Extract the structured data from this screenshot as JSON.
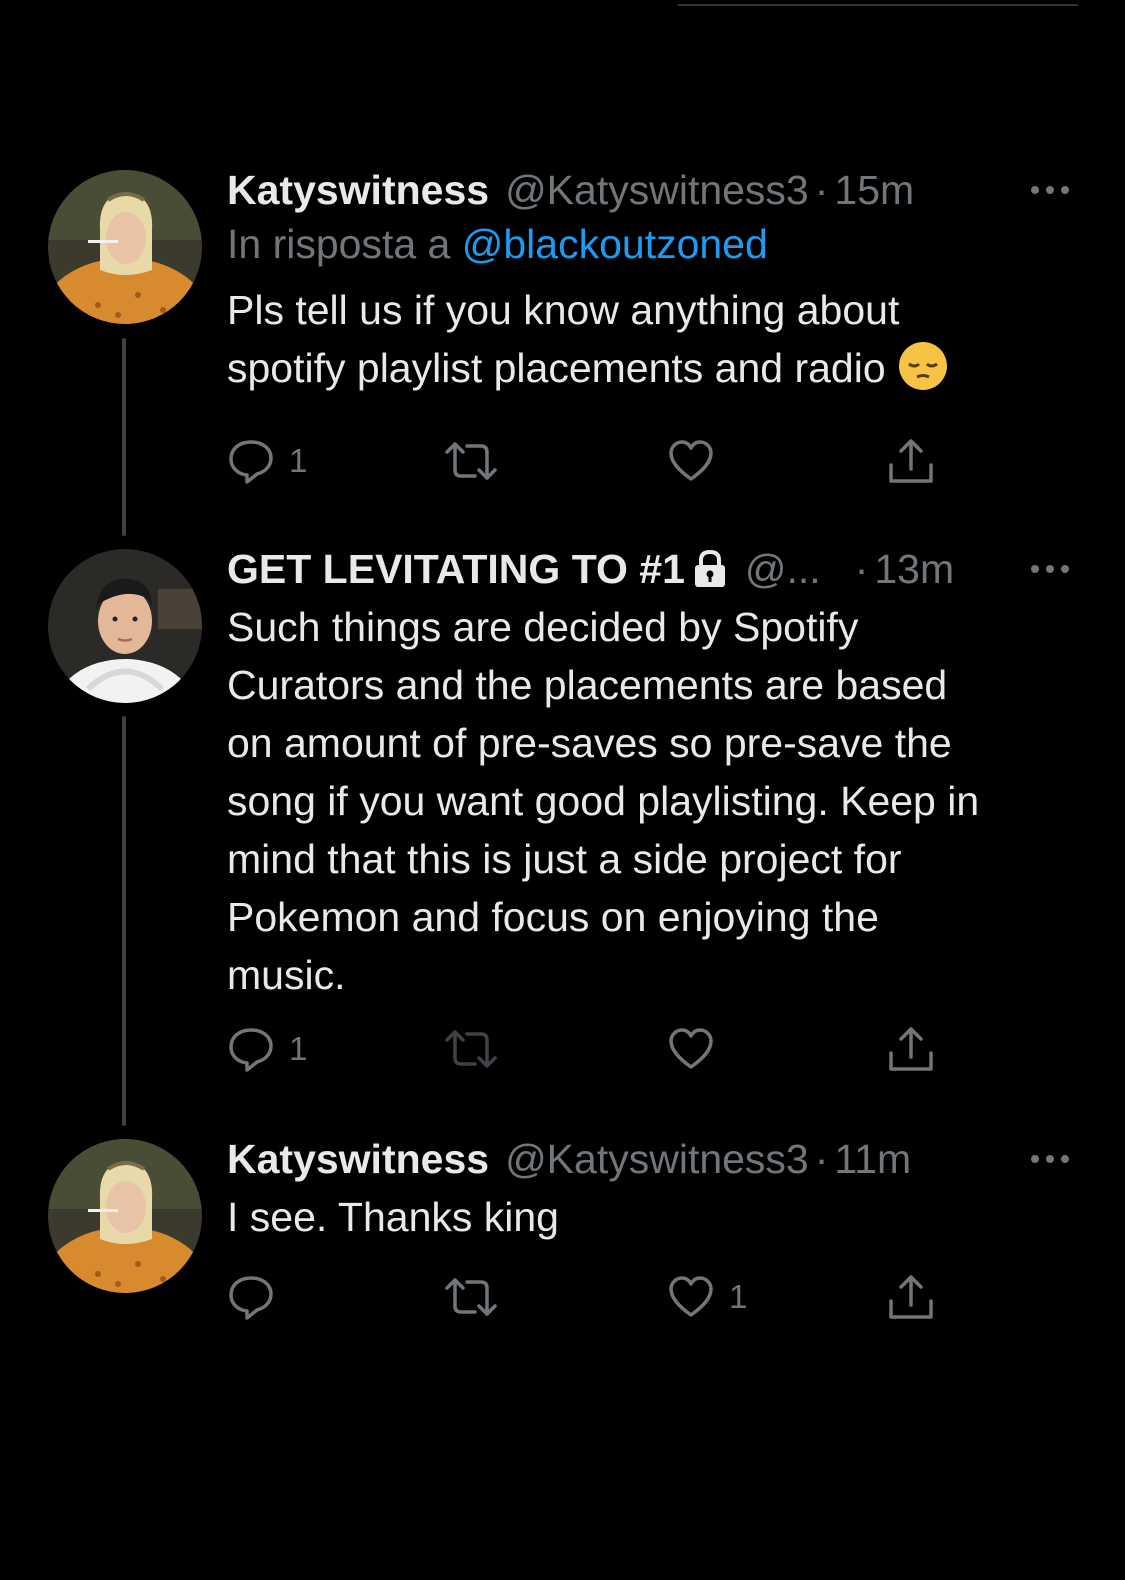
{
  "tweets": [
    {
      "display_name": "Katyswitness",
      "handle": "@Katyswitness3",
      "time": "15m",
      "reply_prefix": "In risposta a",
      "reply_mention": "@blackoutzoned",
      "body_lines": [
        "Pls tell us if you know anything about",
        "spotify playlist placements and radio"
      ],
      "emoji": "pensive-face-emoji",
      "reply_count": "1",
      "retweet_count": "",
      "like_count": "",
      "avatar": "avatar-katyswitness"
    },
    {
      "display_name": "GET LEVITATING TO #1",
      "handle": "@...",
      "time": "13m",
      "body_lines": [
        "Such things are decided by Spotify",
        "Curators and the placements are based",
        "on amount of pre-saves so pre-save the",
        "song if you want good playlisting. Keep in",
        "mind that this is just a side project for",
        "Pokemon and focus on enjoying the",
        "music."
      ],
      "reply_count": "1",
      "retweet_count": "",
      "like_count": "",
      "avatar": "avatar-levitating",
      "icons": [
        "lock-icon"
      ]
    },
    {
      "display_name": "Katyswitness",
      "handle": "@Katyswitness3",
      "time": "11m",
      "body_lines": [
        "I see. Thanks king"
      ],
      "reply_count": "",
      "retweet_count": "",
      "like_count": "1",
      "avatar": "avatar-katyswitness"
    }
  ],
  "separator": "·",
  "colors": {
    "background": "#000000",
    "text": "#e7e9ea",
    "muted": "#71767b",
    "link": "#1d9bf0",
    "thread_line": "#3d4146"
  }
}
